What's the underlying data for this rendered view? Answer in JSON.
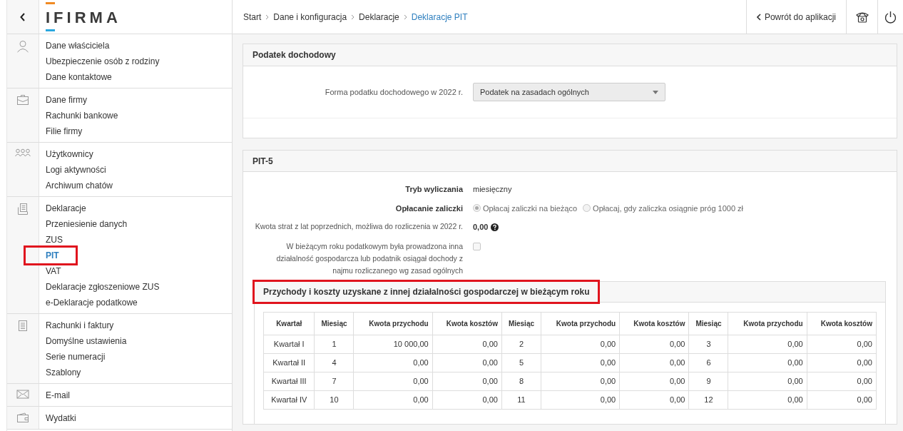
{
  "sidebar": {
    "logo": "IFIRMA",
    "groups": [
      {
        "kind": "person",
        "items": [
          {
            "label": "Dane właściciela",
            "selected": false,
            "highlighted": false
          },
          {
            "label": "Ubezpieczenie osób z rodziny",
            "selected": false,
            "highlighted": false
          },
          {
            "label": "Dane kontaktowe",
            "selected": false,
            "highlighted": false
          }
        ]
      },
      {
        "kind": "briefcase",
        "items": [
          {
            "label": "Dane firmy",
            "selected": false,
            "highlighted": false
          },
          {
            "label": "Rachunki bankowe",
            "selected": false,
            "highlighted": false
          },
          {
            "label": "Filie firmy",
            "selected": false,
            "highlighted": false
          }
        ]
      },
      {
        "kind": "users",
        "items": [
          {
            "label": "Użytkownicy",
            "selected": false,
            "highlighted": false
          },
          {
            "label": "Logi aktywności",
            "selected": false,
            "highlighted": false
          },
          {
            "label": "Archiwum chatów",
            "selected": false,
            "highlighted": false
          }
        ]
      },
      {
        "kind": "documents",
        "items": [
          {
            "label": "Deklaracje",
            "selected": false,
            "highlighted": false
          },
          {
            "label": "Przeniesienie danych",
            "selected": false,
            "highlighted": false
          },
          {
            "label": "ZUS",
            "selected": false,
            "highlighted": false
          },
          {
            "label": "PIT",
            "selected": true,
            "highlighted": true
          },
          {
            "label": "VAT",
            "selected": false,
            "highlighted": false
          },
          {
            "label": "Deklaracje zgłoszeniowe ZUS",
            "selected": false,
            "highlighted": false
          },
          {
            "label": "e-Deklaracje podatkowe",
            "selected": false,
            "highlighted": false
          }
        ]
      },
      {
        "kind": "receipt",
        "items": [
          {
            "label": "Rachunki i faktury",
            "selected": false,
            "highlighted": false
          },
          {
            "label": "Domyślne ustawienia",
            "selected": false,
            "highlighted": false
          },
          {
            "label": "Serie numeracji",
            "selected": false,
            "highlighted": false
          },
          {
            "label": "Szablony",
            "selected": false,
            "highlighted": false
          }
        ]
      },
      {
        "kind": "mail",
        "items": [
          {
            "label": "E-mail",
            "selected": false,
            "highlighted": false
          }
        ]
      },
      {
        "kind": "wallet",
        "items": [
          {
            "label": "Wydatki",
            "selected": false,
            "highlighted": false
          }
        ]
      }
    ]
  },
  "breadcrumbs": [
    {
      "label": "Start",
      "selected": false
    },
    {
      "label": "Dane i konfiguracja",
      "selected": false
    },
    {
      "label": "Deklaracje",
      "selected": false
    },
    {
      "label": "Deklaracje PIT",
      "selected": true
    }
  ],
  "back_link": "Powrót do aplikacji",
  "income_tax": {
    "title": "Podatek dochodowy",
    "label": "Forma podatku dochodowego w 2022 r.",
    "value": "Podatek na zasadach ogólnych"
  },
  "pit5": {
    "title": "PIT-5",
    "mode": {
      "label": "Tryb wyliczania",
      "value": "miesięczny"
    },
    "payment": {
      "label": "Opłacanie zaliczki",
      "options": [
        {
          "label": "Opłacaj zaliczki na bieżąco",
          "selected": true
        },
        {
          "label": "Opłacaj, gdy zaliczka osiągnie próg 1000 zł",
          "selected": false
        }
      ]
    },
    "losses": {
      "label": "Kwota strat z lat poprzednich, możliwa do rozliczenia w 2022 r.",
      "value": "0,00"
    },
    "other_activity": {
      "label": "W bieżącym roku podatkowym była prowadzona inna działalność gospodarcza lub podatnik osiągał dochody z najmu rozliczanego wg zasad ogólnych",
      "checked": false
    },
    "subsection": {
      "title": "Przychody i koszty uzyskane z innej działalności gospodarczej w bieżącym roku",
      "highlighted": true,
      "columns": [
        "Kwartał",
        "Miesiąc",
        "Kwota przychodu",
        "Kwota kosztów",
        "Miesiąc",
        "Kwota przychodu",
        "Kwota kosztów",
        "Miesiąc",
        "Kwota przychodu",
        "Kwota kosztów"
      ],
      "rows": [
        [
          "Kwartał I",
          "1",
          "10 000,00",
          "0,00",
          "2",
          "0,00",
          "0,00",
          "3",
          "0,00",
          "0,00"
        ],
        [
          "Kwartał II",
          "4",
          "0,00",
          "0,00",
          "5",
          "0,00",
          "0,00",
          "6",
          "0,00",
          "0,00"
        ],
        [
          "Kwartał III",
          "7",
          "0,00",
          "0,00",
          "8",
          "0,00",
          "0,00",
          "9",
          "0,00",
          "0,00"
        ],
        [
          "Kwartał IV",
          "10",
          "0,00",
          "0,00",
          "11",
          "0,00",
          "0,00",
          "12",
          "0,00",
          "0,00"
        ]
      ]
    }
  }
}
